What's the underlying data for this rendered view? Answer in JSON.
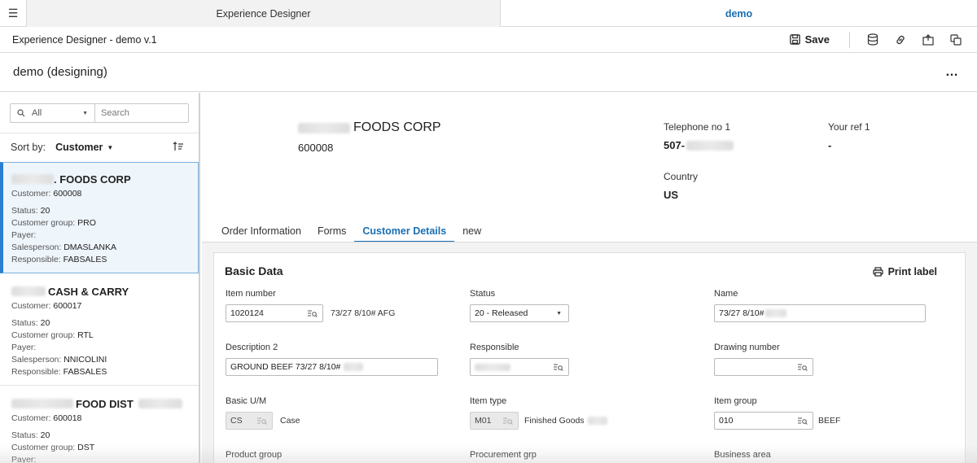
{
  "topbar": {
    "menu_icon": "hamburger-icon",
    "tab_left": "Experience Designer",
    "tab_right": "demo"
  },
  "subbar": {
    "title": "Experience Designer - demo v.1",
    "save_label": "Save",
    "icons": [
      "save-icon",
      "database-icon",
      "link-icon",
      "export-icon",
      "copy-icon"
    ]
  },
  "page": {
    "title": "demo (designing)",
    "more": "…"
  },
  "left": {
    "filter_all": "All",
    "search_placeholder": "Search",
    "sort_label": "Sort by:",
    "sort_value": "Customer",
    "cards": [
      {
        "name": ". FOODS CORP",
        "customer": "600008",
        "status": "20",
        "group": "PRO",
        "payer": "",
        "salesperson": "DMASLANKA",
        "responsible": "FABSALES"
      },
      {
        "name": "CASH & CARRY",
        "customer": "600017",
        "status": "20",
        "group": "RTL",
        "payer": "",
        "salesperson": "NNICOLINI",
        "responsible": "FABSALES"
      },
      {
        "name": "FOOD DIST",
        "customer": "600018",
        "status": "20",
        "group": "DST",
        "payer": ""
      }
    ],
    "labels": {
      "customer": "Customer:",
      "status": "Status:",
      "group": "Customer group:",
      "payer": "Payer:",
      "salesperson": "Salesperson:",
      "responsible": "Responsible:"
    }
  },
  "header": {
    "name": "FOODS CORP",
    "number": "600008",
    "tel_label": "Telephone no 1",
    "tel_value": "507-",
    "ref_label": "Your ref 1",
    "ref_value": "-",
    "country_label": "Country",
    "country_value": "US"
  },
  "tabs": [
    "Order Information",
    "Forms",
    "Customer Details",
    "new"
  ],
  "panel": {
    "title": "Basic Data",
    "print_label": "Print label",
    "fields": {
      "item_number_label": "Item number",
      "item_number_value": "1020124",
      "item_number_desc": "73/27 8/10# AFG",
      "status_label": "Status",
      "status_value": "20 - Released",
      "name_label": "Name",
      "name_value": "73/27 8/10#",
      "desc2_label": "Description 2",
      "desc2_value": "GROUND BEEF 73/27 8/10#",
      "responsible_label": "Responsible",
      "drawing_label": "Drawing number",
      "um_label": "Basic U/M",
      "um_value": "CS",
      "um_desc": "Case",
      "itemtype_label": "Item type",
      "itemtype_value": "M01",
      "itemtype_desc": "Finished Goods",
      "itemgroup_label": "Item group",
      "itemgroup_value": "010",
      "itemgroup_desc": "BEEF",
      "product_group_label": "Product group",
      "procurement_label": "Procurement grp",
      "business_area_label": "Business area"
    }
  }
}
